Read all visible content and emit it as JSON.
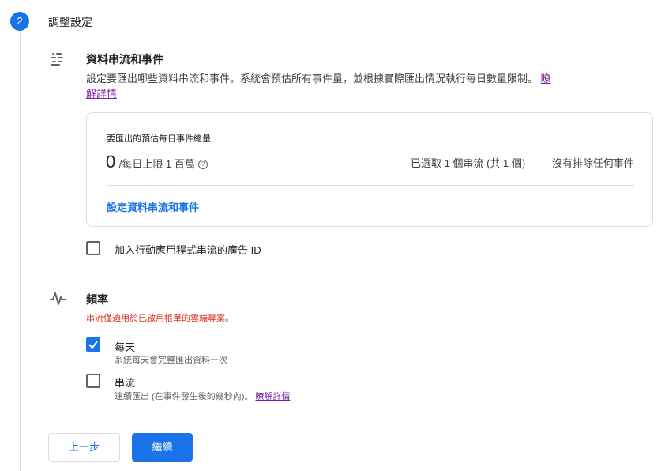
{
  "step": {
    "number": "2",
    "title": "調整設定"
  },
  "streams_section": {
    "icon": "streams-list-icon",
    "title": "資料串流和事件",
    "description_line1": "設定要匯出哪些資料串流和事件。系統會預估所有事件量，並根據實際匯出情況執行每日數量限制。",
    "learn_more_part1": "瞭",
    "learn_more_part2": "解詳情"
  },
  "estimate_card": {
    "label": "要匯出的預估每日事件總量",
    "value": "0",
    "limit_text": "/每日上限 1 百萬",
    "help_icon": "help-circle-icon",
    "selected_streams": "已選取 1 個串流 (共 1 個)",
    "excluded_events": "沒有排除任何事件",
    "configure_link": "設定資料串流和事件"
  },
  "advertising_id": {
    "label": "加入行動應用程式串流的廣告 ID",
    "checked": false
  },
  "frequency_section": {
    "icon": "activity-pulse-icon",
    "title": "頻率",
    "warning": "串流僅適用於已啟用帳單的雲端專案。",
    "options": [
      {
        "label": "每天",
        "sub": "系統每天會完整匯出資料一次",
        "checked": true
      },
      {
        "label": "串流",
        "sub": "連續匯出 (在事件發生後的幾秒內)。",
        "link": "瞭解詳情",
        "checked": false
      }
    ]
  },
  "buttons": {
    "back": "上一步",
    "continue": "繼續"
  },
  "colors": {
    "primary": "#1a73e8",
    "warning": "#d93025",
    "link_visited": "#7b1fa2"
  }
}
